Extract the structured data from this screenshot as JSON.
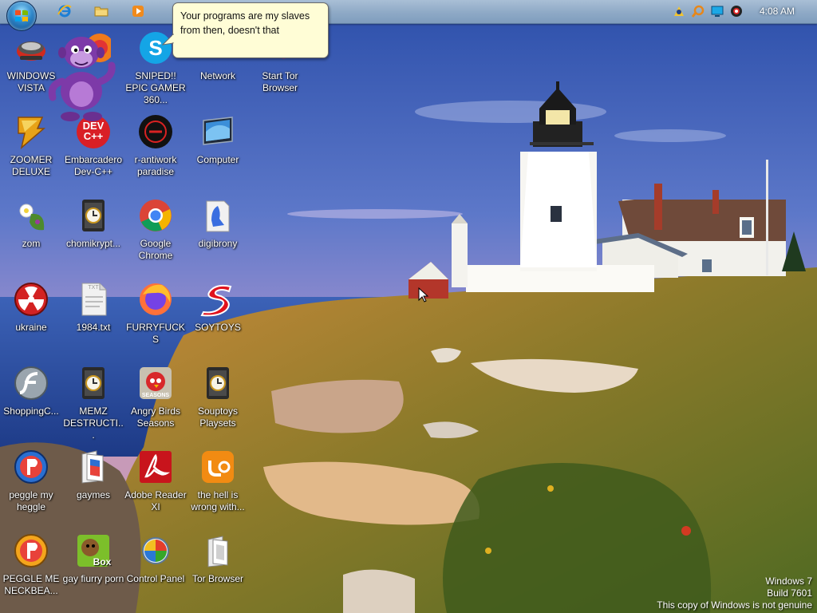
{
  "taskbar": {
    "pinned": [
      "internet-explorer-icon",
      "explorer-folder-icon",
      "media-player-icon"
    ],
    "tray": [
      "buddy-tray-icon",
      "search-tray-icon",
      "monitor-tray-icon",
      "record-tray-icon"
    ],
    "clock": "4:08 AM"
  },
  "tooltip": {
    "text": "Your programs are my slaves from then, doesn't that"
  },
  "desktop": {
    "icons": [
      {
        "label": "WINDOWS VISTA",
        "icon": "vista-app-icon"
      },
      {
        "label": "",
        "icon": "bonzi-buddy-icon"
      },
      {
        "label": "SNIPED!! EPIC GAMER 360...",
        "icon": "skype-icon"
      },
      {
        "label": "Network",
        "icon": "network-icon"
      },
      {
        "label": "Start Tor Browser",
        "icon": "tor-icon"
      },
      {
        "label": "ZOOMER DELUXE",
        "icon": "zoomer-icon"
      },
      {
        "label": "Embarcadero Dev-C++",
        "icon": "devcpp-icon"
      },
      {
        "label": "r-antiwork paradise",
        "icon": "antiwork-icon"
      },
      {
        "label": "Computer",
        "icon": "computer-icon"
      },
      {
        "label": "zom",
        "icon": "zom-icon"
      },
      {
        "label": "chomikrypt...",
        "icon": "clock-file-icon"
      },
      {
        "label": "Google Chrome",
        "icon": "chrome-icon"
      },
      {
        "label": "digibrony",
        "icon": "digibrony-icon"
      },
      {
        "label": "ukraine",
        "icon": "radiation-icon"
      },
      {
        "label": "1984.txt",
        "icon": "text-file-icon"
      },
      {
        "label": "FURRYFUCKS",
        "icon": "firefox-icon"
      },
      {
        "label": "SOYTOYS",
        "icon": "soytoys-icon"
      },
      {
        "label": "ShoppingC...",
        "icon": "flash-icon"
      },
      {
        "label": "MEMZ DESTRUCTI...",
        "icon": "clock-file-icon"
      },
      {
        "label": "Angry Birds Seasons",
        "icon": "angry-birds-icon"
      },
      {
        "label": "Souptoys Playsets",
        "icon": "clock-file-icon"
      },
      {
        "label": "peggle my heggle",
        "icon": "peggle-icon"
      },
      {
        "label": "gaymes",
        "icon": "gaymes-icon"
      },
      {
        "label": "Adobe Reader XI",
        "icon": "adobe-reader-icon"
      },
      {
        "label": "the hell is wrong with...",
        "icon": "uc-browser-icon"
      },
      {
        "label": "PEGGLE ME NECKBEA...",
        "icon": "peggle-icon"
      },
      {
        "label": "gay fiurry porn",
        "icon": "box-app-icon"
      },
      {
        "label": "Control Panel",
        "icon": "control-panel-icon"
      },
      {
        "label": "Tor Browser",
        "icon": "tor-browser-folder-icon"
      }
    ],
    "dev_icon_text": "DEV C++",
    "box_icon_text": "Box",
    "seasons_text": "SEASONS",
    "txt_icon_text": "TXT"
  },
  "watermark": {
    "line1": "Windows 7",
    "line2": "Build 7601",
    "line3": "This copy of Windows is not genuine"
  },
  "colors": {
    "taskbar": "#8ea9c6",
    "tooltip_bg": "#fffdd6",
    "sky": "#3a5bb0"
  }
}
